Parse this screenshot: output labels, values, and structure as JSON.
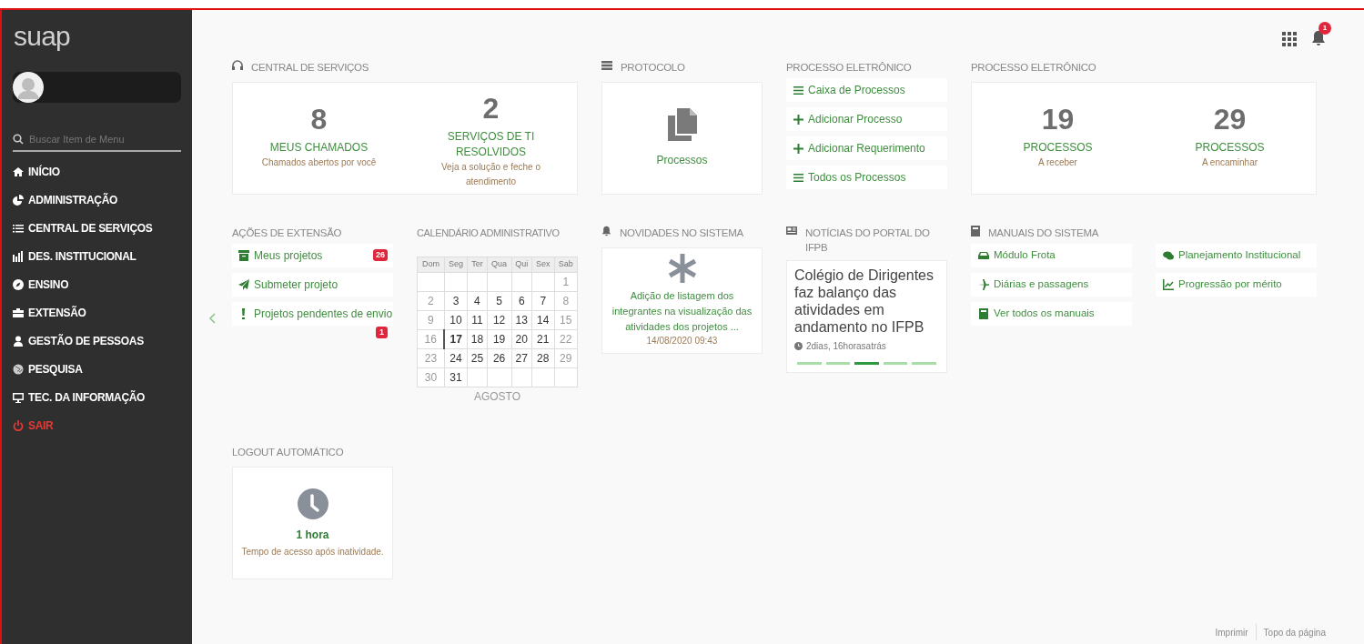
{
  "sidebar": {
    "logo": "suap",
    "search": {
      "placeholder": "Buscar Item de Menu"
    },
    "items": [
      {
        "label": "INÍCIO",
        "kind": "menu"
      },
      {
        "label": "ADMINISTRAÇÃO",
        "kind": "menu"
      },
      {
        "label": "CENTRAL DE SERVIÇOS",
        "kind": "menu"
      },
      {
        "label": "DES. INSTITUCIONAL",
        "kind": "menu"
      },
      {
        "label": "ENSINO",
        "kind": "menu"
      },
      {
        "label": "EXTENSÃO",
        "kind": "menu"
      },
      {
        "label": "GESTÃO DE PESSOAS",
        "kind": "menu"
      },
      {
        "label": "PESQUISA",
        "kind": "menu"
      },
      {
        "label": "TEC. DA INFORMAÇÃO",
        "kind": "menu"
      },
      {
        "label": "SAIR",
        "kind": "exit"
      }
    ]
  },
  "topbar": {
    "notifications": "1"
  },
  "central_servicos": {
    "title": "CENTRAL DE SERVIÇOS",
    "stats": [
      {
        "value": "8",
        "label": "MEUS CHAMADOS",
        "sub": "Chamados abertos por você"
      },
      {
        "value": "2",
        "label": "SERVIÇOS DE TI RESOLVIDOS",
        "sub": "Veja a solução e feche o atendimento"
      }
    ]
  },
  "protocolo": {
    "title": "PROTOCOLO",
    "link": "Processos"
  },
  "processo_links": {
    "title": "PROCESSO ELETRÔNICO",
    "items": [
      "Caixa de Processos",
      "Adicionar Processo",
      "Adicionar Requerimento",
      "Todos os Processos"
    ]
  },
  "processo_stats": {
    "title": "PROCESSO ELETRÔNICO",
    "stats": [
      {
        "value": "19",
        "label": "PROCESSOS",
        "sub": "A receber"
      },
      {
        "value": "29",
        "label": "PROCESSOS",
        "sub": "A encaminhar"
      }
    ]
  },
  "acoes_extensao": {
    "title": "AÇÕES DE EXTENSÃO",
    "items": [
      {
        "label": "Meus projetos",
        "badge": "26"
      },
      {
        "label": "Submeter projeto"
      },
      {
        "label": "Projetos pendentes de envio",
        "badge": "1"
      }
    ]
  },
  "calendario": {
    "title": "CALENDÁRIO ADMINISTRATIVO",
    "month": "AGOSTO",
    "weekdays": [
      "Dom",
      "Seg",
      "Ter",
      "Qua",
      "Qui",
      "Sex",
      "Sab"
    ],
    "weeks": [
      {
        "kind": "first",
        "days": [
          {
            "d": "1",
            "today": false
          }
        ]
      },
      {
        "kind": "week",
        "days": [
          {
            "d": "2",
            "today": false
          },
          {
            "d": "3",
            "today": false
          },
          {
            "d": "4",
            "today": false
          },
          {
            "d": "5",
            "today": false
          },
          {
            "d": "6",
            "today": false
          },
          {
            "d": "7",
            "today": false
          },
          {
            "d": "8",
            "today": false
          }
        ]
      },
      {
        "kind": "week",
        "days": [
          {
            "d": "9",
            "today": false
          },
          {
            "d": "10",
            "today": false
          },
          {
            "d": "11",
            "today": false
          },
          {
            "d": "12",
            "today": false
          },
          {
            "d": "13",
            "today": false
          },
          {
            "d": "14",
            "today": false
          },
          {
            "d": "15",
            "today": false
          }
        ]
      },
      {
        "kind": "week",
        "days": [
          {
            "d": "16",
            "today": false
          },
          {
            "d": "17",
            "today": true
          },
          {
            "d": "18",
            "today": false
          },
          {
            "d": "19",
            "today": false
          },
          {
            "d": "20",
            "today": false
          },
          {
            "d": "21",
            "today": false
          },
          {
            "d": "22",
            "today": false
          }
        ]
      },
      {
        "kind": "week",
        "days": [
          {
            "d": "23",
            "today": false
          },
          {
            "d": "24",
            "today": false
          },
          {
            "d": "25",
            "today": false
          },
          {
            "d": "26",
            "today": false
          },
          {
            "d": "27",
            "today": false
          },
          {
            "d": "28",
            "today": false
          },
          {
            "d": "29",
            "today": false
          }
        ]
      },
      {
        "kind": "week",
        "days": [
          {
            "d": "30",
            "today": false
          },
          {
            "d": "31",
            "today": false
          }
        ]
      }
    ]
  },
  "novidades": {
    "title": "NOVIDADES NO SISTEMA",
    "text": "Adição de listagem dos integrantes na visualização das atividades dos projetos ...",
    "date": "14/08/2020 09:43"
  },
  "noticias": {
    "title": "NOTÍCIAS DO PORTAL DO IFPB",
    "headline": "Colégio de Dirigentes faz balanço das atividades em andamento no IFPB",
    "time": "2dias, 16horasatrás",
    "pager": [
      {
        "selected": false
      },
      {
        "selected": false
      },
      {
        "selected": true
      },
      {
        "selected": false
      },
      {
        "selected": false
      }
    ]
  },
  "manuais": {
    "title": "MANUAIS DO SISTEMA",
    "items": [
      "Módulo Frota",
      "Planejamento Institucional",
      "Diárias e passagens",
      "Progressão por mérito",
      "Ver todos os manuais"
    ]
  },
  "logout": {
    "title": "LOGOUT AUTOMÁTICO",
    "value": "1 hora",
    "sub": "Tempo de acesso após inatividade."
  },
  "footer": {
    "links": [
      "Imprimir",
      "Topo da página"
    ]
  }
}
